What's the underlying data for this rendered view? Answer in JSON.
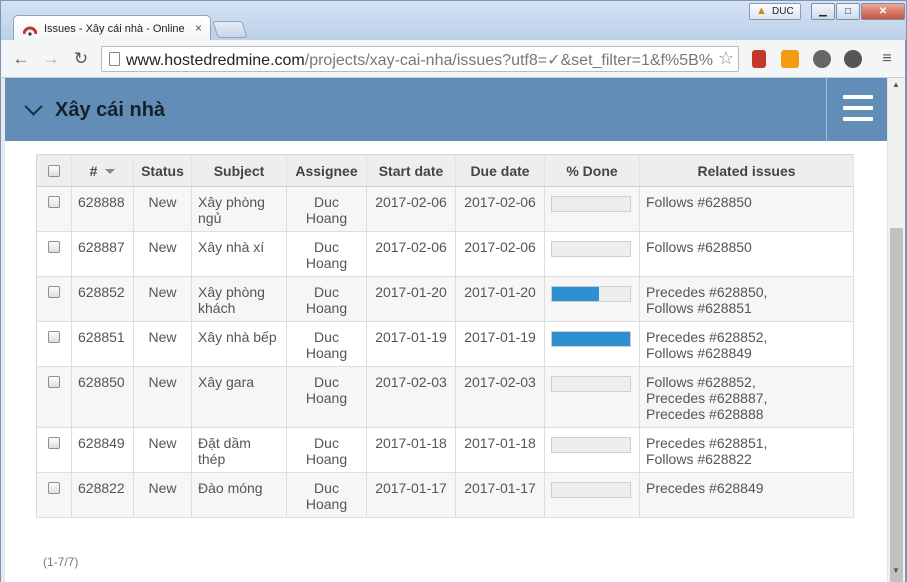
{
  "window": {
    "tab_title": "Issues - Xây cái nhà - Online",
    "user": "DUC",
    "minimize_symbol": "▁",
    "maximize_symbol": "□",
    "close_symbol": "✕"
  },
  "toolbar": {
    "url_host": "www.hostedredmine.com",
    "url_path": "/projects/xay-cai-nha/issues?utf8=✓&set_filter=1&f%5B%"
  },
  "header": {
    "project_title": "Xây cái nhà"
  },
  "table": {
    "columns": {
      "id": "#",
      "status": "Status",
      "subject": "Subject",
      "assignee": "Assignee",
      "start_date": "Start date",
      "due_date": "Due date",
      "done": "% Done",
      "related": "Related issues"
    },
    "rows": [
      {
        "id": "628888",
        "status": "New",
        "subject": "Xây phòng ngủ",
        "assignee": "Duc Hoang",
        "start": "2017-02-06",
        "due": "2017-02-06",
        "done": 0,
        "related": [
          "Follows #628850"
        ]
      },
      {
        "id": "628887",
        "status": "New",
        "subject": "Xây nhà xí",
        "assignee": "Duc Hoang",
        "start": "2017-02-06",
        "due": "2017-02-06",
        "done": 0,
        "related": [
          "Follows #628850"
        ]
      },
      {
        "id": "628852",
        "status": "New",
        "subject": "Xây phòng khách",
        "assignee": "Duc Hoang",
        "start": "2017-01-20",
        "due": "2017-01-20",
        "done": 60,
        "related": [
          "Precedes #628850,",
          "Follows #628851"
        ]
      },
      {
        "id": "628851",
        "status": "New",
        "subject": "Xây nhà bếp",
        "assignee": "Duc Hoang",
        "start": "2017-01-19",
        "due": "2017-01-19",
        "done": 100,
        "related": [
          "Precedes #628852,",
          "Follows #628849"
        ]
      },
      {
        "id": "628850",
        "status": "New",
        "subject": "Xây gara",
        "assignee": "Duc Hoang",
        "start": "2017-02-03",
        "due": "2017-02-03",
        "done": 0,
        "related": [
          "Follows #628852,",
          "Precedes #628887,",
          "Precedes #628888"
        ]
      },
      {
        "id": "628849",
        "status": "New",
        "subject": "Đặt dầm thép",
        "assignee": "Duc Hoang",
        "start": "2017-01-18",
        "due": "2017-01-18",
        "done": 0,
        "related": [
          "Precedes #628851,",
          "Follows #628822"
        ]
      },
      {
        "id": "628822",
        "status": "New",
        "subject": "Đào móng",
        "assignee": "Duc Hoang",
        "start": "2017-01-17",
        "due": "2017-01-17",
        "done": 0,
        "related": [
          "Precedes #628849"
        ]
      }
    ]
  },
  "pagination": "(1-7/7)",
  "colors": {
    "header_bg": "#628db6",
    "progress_fill": "#2e8fd1"
  }
}
